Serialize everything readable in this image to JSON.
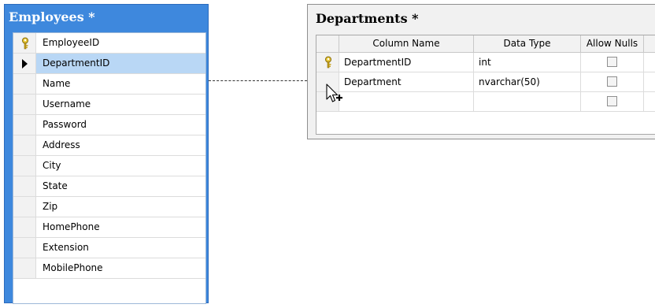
{
  "employees": {
    "title": "Employees *",
    "rows": [
      {
        "name": "EmployeeID",
        "icon": "key-icon"
      },
      {
        "name": "DepartmentID",
        "icon": "row-selector-arrow-icon",
        "selected": true
      },
      {
        "name": "Name"
      },
      {
        "name": "Username"
      },
      {
        "name": "Password"
      },
      {
        "name": "Address"
      },
      {
        "name": "City"
      },
      {
        "name": "State"
      },
      {
        "name": "Zip"
      },
      {
        "name": "HomePhone"
      },
      {
        "name": "Extension"
      },
      {
        "name": "MobilePhone"
      }
    ]
  },
  "departments": {
    "title": "Departments *",
    "headers": {
      "column_name": "Column Name",
      "data_type": "Data Type",
      "allow_nulls": "Allow Nulls"
    },
    "rows": [
      {
        "column_name": "DepartmentID",
        "data_type": "int",
        "allow_nulls": false,
        "icon": "key-icon"
      },
      {
        "column_name": "Department",
        "data_type": "nvarchar(50)",
        "allow_nulls": false
      },
      {
        "column_name": "",
        "data_type": "",
        "allow_nulls": false
      }
    ]
  },
  "colors": {
    "employees_header": "#3e88dd",
    "selected_row": "#b9d7f5",
    "departments_background": "#f1f1f1"
  }
}
